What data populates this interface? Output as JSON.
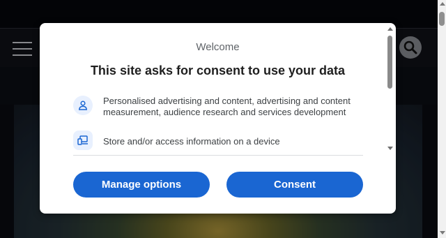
{
  "consent_dialog": {
    "welcome": "Welcome",
    "headline": "This site asks for consent to use your data",
    "purposes": [
      {
        "icon": "person-icon",
        "text": "Personalised advertising and content, advertising and content measurement, audience research and services development"
      },
      {
        "icon": "devices-icon",
        "text": "Store and/or access information on a device"
      }
    ],
    "buttons": {
      "manage_label": "Manage options",
      "consent_label": "Consent"
    }
  },
  "colors": {
    "accent": "#1a66d2",
    "icon_bg": "#e8f0fe",
    "page_bg": "#0a0c12"
  }
}
